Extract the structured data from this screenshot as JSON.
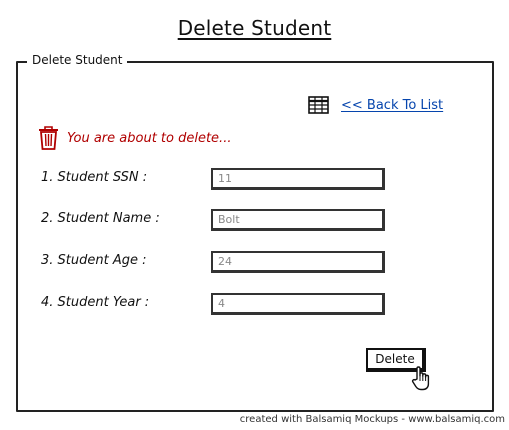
{
  "page": {
    "title": "Delete Student"
  },
  "panel": {
    "legend": "Delete Student"
  },
  "navigation": {
    "back_link_label": "<< Back To List",
    "back_link_icon": "table-grid-icon"
  },
  "warning": {
    "icon": "trash-icon",
    "text": "You are about to delete...",
    "color": "#b00000"
  },
  "form": {
    "fields": [
      {
        "label": "1. Student SSN :",
        "value": "11"
      },
      {
        "label": "2. Student Name :",
        "value": "Bolt"
      },
      {
        "label": "3. Student Age :",
        "value": "24"
      },
      {
        "label": "4. Student Year :",
        "value": "4"
      }
    ]
  },
  "actions": {
    "delete_label": "Delete",
    "cursor_icon": "hand-pointer-icon"
  },
  "footer": {
    "credit": "created with Balsamiq Mockups - www.balsamiq.com"
  },
  "theme": {
    "link_color": "#0645ad",
    "input_text_color": "#888888",
    "border_color": "#222222"
  }
}
